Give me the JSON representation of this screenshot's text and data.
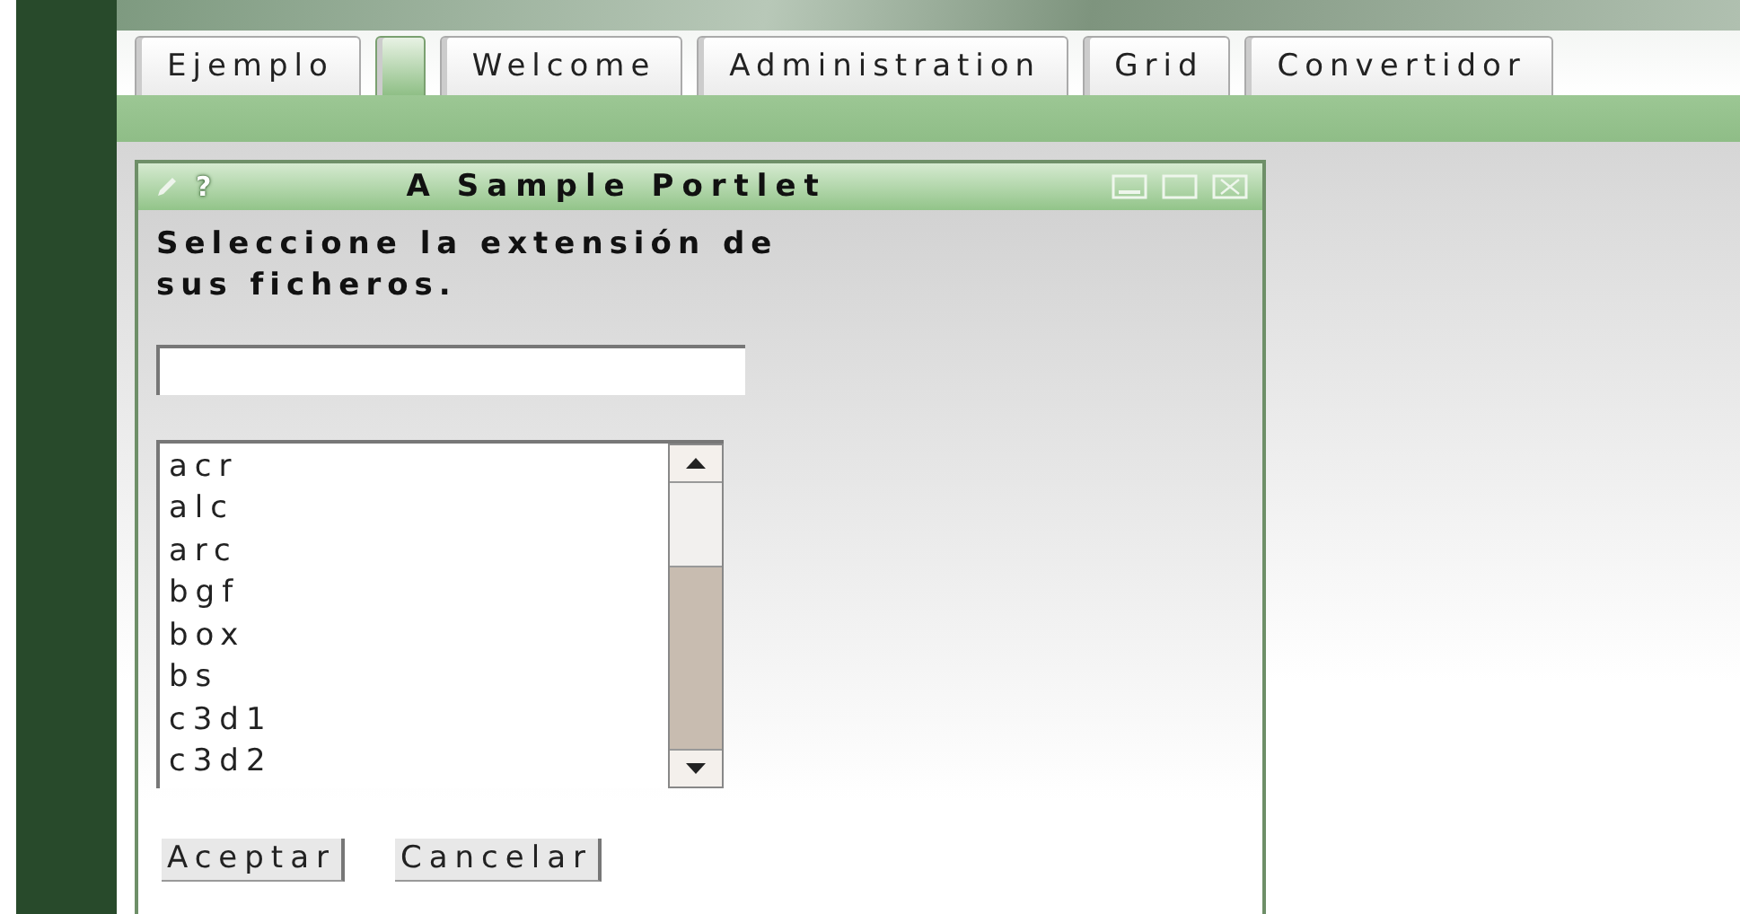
{
  "tabs": [
    {
      "label": "Ejemplo",
      "selected": false
    },
    {
      "selected": true
    },
    {
      "label": "Welcome",
      "selected": false
    },
    {
      "label": "Administration",
      "selected": false
    },
    {
      "label": "Grid",
      "selected": false
    },
    {
      "label": "Convertidor",
      "selected": false
    }
  ],
  "portlet": {
    "title": "A Sample Portlet",
    "help": "?",
    "prompt": "Seleccione la extensión de sus ficheros.",
    "extensions": [
      "acr",
      "alc",
      "arc",
      "bgf",
      "box",
      "bs",
      "c3d1",
      "c3d2"
    ],
    "buttons": [
      "Aceptar",
      "Cancelar"
    ]
  }
}
